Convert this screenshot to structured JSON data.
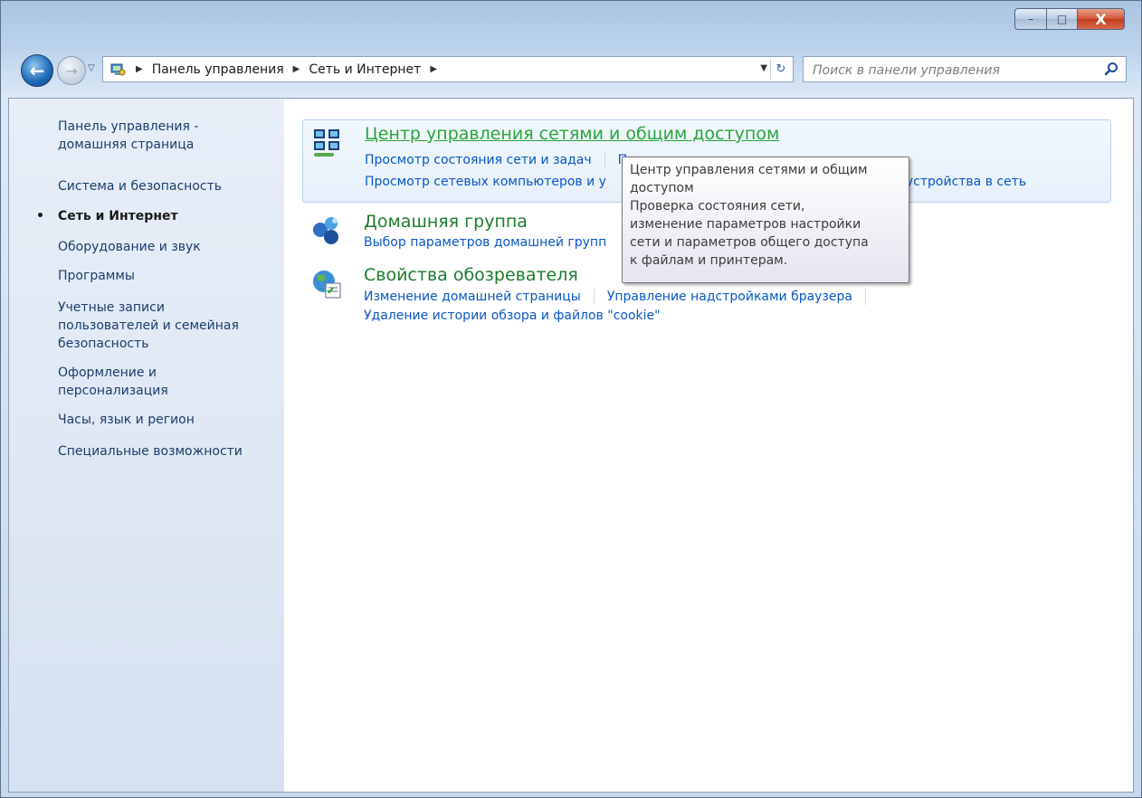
{
  "window": {
    "controls": {
      "minimize": "–",
      "maximize": "□",
      "close": "X"
    }
  },
  "nav": {
    "back_glyph": "←",
    "forward_glyph": "→",
    "recent_glyph": "▽",
    "breadcrumb": [
      {
        "label": "Панель управления"
      },
      {
        "label": "Сеть и Интернет"
      }
    ],
    "crumb_separator": "▶",
    "dropdown_glyph": "▼",
    "refresh_glyph": "↻",
    "search_placeholder": "Поиск в панели управления"
  },
  "sidebar": {
    "items": [
      {
        "label": "Панель управления - домашняя страница",
        "lines": [
          "Панель управления -",
          "домашняя страница"
        ]
      },
      {
        "label": "Система и безопасность"
      },
      {
        "label": "Сеть и Интернет",
        "active": true,
        "bullet": "•"
      },
      {
        "label": "Оборудование и звук"
      },
      {
        "label": "Программы"
      },
      {
        "label": "Учетные записи пользователей и семейная безопасность",
        "lines": [
          "Учетные записи",
          "пользователей и семейная",
          "безопасность"
        ]
      },
      {
        "label": "Оформление и персонализация",
        "lines": [
          "Оформление и",
          "персонализация"
        ]
      },
      {
        "label": "Часы, язык и регион"
      },
      {
        "label": "Специальные возможности"
      }
    ]
  },
  "categories": [
    {
      "title": "Центр управления сетями и общим доступом",
      "icon": "network-center-icon",
      "rows": [
        [
          "Просмотр состояния сети и задач",
          "Подключение к сети"
        ],
        [
          "Просмотр сетевых компьютеров и у",
          "ого устройства в сеть"
        ]
      ]
    },
    {
      "title": "Домашняя группа",
      "icon": "homegroup-icon",
      "rows": [
        [
          "Выбор параметров домашней групп"
        ]
      ]
    },
    {
      "title": "Свойства обозревателя",
      "icon": "internet-options-icon",
      "rows": [
        [
          "Изменение домашней страницы",
          "Управление надстройками браузера"
        ],
        [
          "Удаление истории обзора и файлов \"cookie\""
        ]
      ]
    }
  ],
  "tooltip": {
    "lines": [
      "Центр управления сетями и общим",
      "доступом",
      "Проверка состояния сети,",
      "изменение параметров настройки",
      "сети и параметров общего доступа",
      "к файлам и принтерам."
    ]
  },
  "colors": {
    "link": "#0a57c4",
    "category_title": "#1e7b2e",
    "category_title_hover": "#29a63a",
    "sidebar_text": "#1c3d6b"
  }
}
